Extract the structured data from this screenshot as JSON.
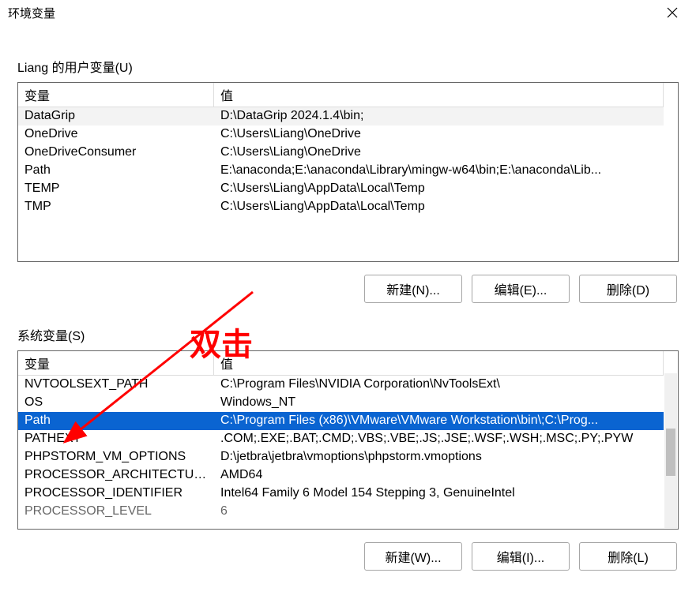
{
  "window": {
    "title": "环境变量"
  },
  "user_section": {
    "label": "Liang 的用户变量(U)",
    "columns": {
      "var": "变量",
      "val": "值"
    },
    "rows": [
      {
        "var": "DataGrip",
        "val": "D:\\DataGrip 2024.1.4\\bin;"
      },
      {
        "var": "OneDrive",
        "val": "C:\\Users\\Liang\\OneDrive"
      },
      {
        "var": "OneDriveConsumer",
        "val": "C:\\Users\\Liang\\OneDrive"
      },
      {
        "var": "Path",
        "val": "E:\\anaconda;E:\\anaconda\\Library\\mingw-w64\\bin;E:\\anaconda\\Lib..."
      },
      {
        "var": "TEMP",
        "val": "C:\\Users\\Liang\\AppData\\Local\\Temp"
      },
      {
        "var": "TMP",
        "val": "C:\\Users\\Liang\\AppData\\Local\\Temp"
      }
    ],
    "buttons": {
      "new": "新建(N)...",
      "edit": "编辑(E)...",
      "delete": "删除(D)"
    }
  },
  "sys_section": {
    "label": "系统变量(S)",
    "columns": {
      "var": "变量",
      "val": "值"
    },
    "rows": [
      {
        "var": "NVTOOLSEXT_PATH",
        "val": "C:\\Program Files\\NVIDIA Corporation\\NvToolsExt\\"
      },
      {
        "var": "OS",
        "val": "Windows_NT"
      },
      {
        "var": "Path",
        "val": "C:\\Program Files (x86)\\VMware\\VMware Workstation\\bin\\;C:\\Prog..."
      },
      {
        "var": "PATHEXT",
        "val": ".COM;.EXE;.BAT;.CMD;.VBS;.VBE;.JS;.JSE;.WSF;.WSH;.MSC;.PY;.PYW"
      },
      {
        "var": "PHPSTORM_VM_OPTIONS",
        "val": "D:\\jetbra\\jetbra\\vmoptions\\phpstorm.vmoptions"
      },
      {
        "var": "PROCESSOR_ARCHITECTURE",
        "val": "AMD64"
      },
      {
        "var": "PROCESSOR_IDENTIFIER",
        "val": "Intel64 Family 6 Model 154 Stepping 3, GenuineIntel"
      },
      {
        "var": "PROCESSOR_LEVEL",
        "val": "6"
      }
    ],
    "selected_index": 2,
    "buttons": {
      "new": "新建(W)...",
      "edit": "编辑(I)...",
      "delete": "删除(L)"
    }
  },
  "annotation": {
    "label": "双击"
  }
}
